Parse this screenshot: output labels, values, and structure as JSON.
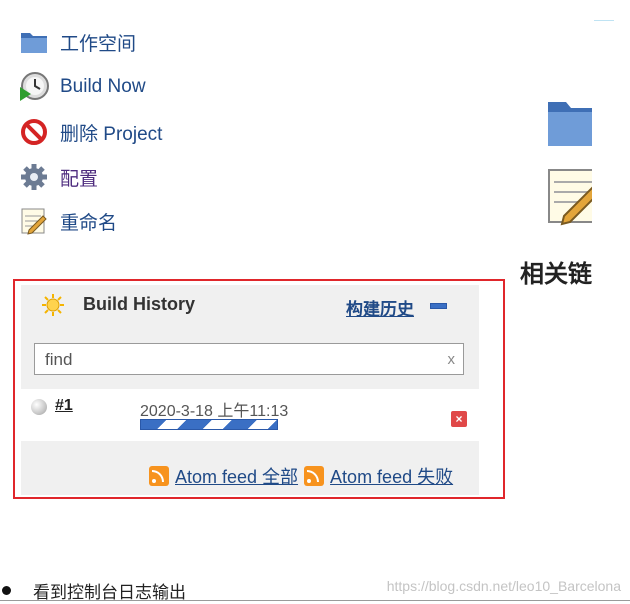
{
  "sidebar": {
    "items": [
      {
        "label": "工作空间",
        "icon": "folder-icon"
      },
      {
        "label": "Build Now",
        "icon": "clock-play-icon"
      },
      {
        "label": "删除 Project",
        "icon": "no-entry-icon"
      },
      {
        "label": "配置",
        "icon": "gear-icon"
      },
      {
        "label": "重命名",
        "icon": "notepad-icon"
      }
    ]
  },
  "right": {
    "heading": "相关链"
  },
  "history": {
    "title": "Build History",
    "trend_link": "构建历史",
    "search_placeholder": "find",
    "search_clear": "x",
    "builds": [
      {
        "number": "#1",
        "time": "2020-3-18 上午11:13",
        "progress": 0.95
      }
    ],
    "feed_all": "Atom feed 全部",
    "feed_fail": "Atom feed 失败"
  },
  "body_text": {
    "bullet": "看到控制台日志输出"
  },
  "watermark": "https://blog.csdn.net/leo10_Barcelona",
  "colors": {
    "link": "#204a87",
    "highlight_border": "#e0262b",
    "progress": "#3a6fc4"
  }
}
